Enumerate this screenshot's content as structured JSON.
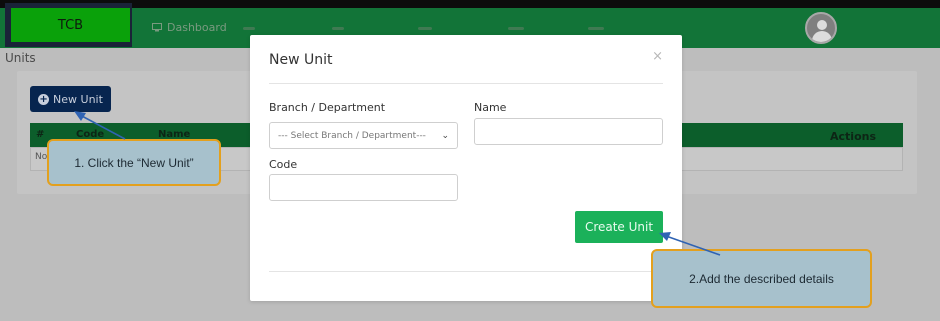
{
  "navbar": {
    "brand": "TCB",
    "dashboard_label": "Dashboard"
  },
  "page": {
    "title": "Units",
    "new_unit_button": "New Unit",
    "table": {
      "columns": [
        "#",
        "Code",
        "Name"
      ],
      "actions_header": "Actions",
      "empty_row_text": "No"
    }
  },
  "modal": {
    "title": "New Unit",
    "close": "×",
    "branch_label": "Branch / Department",
    "branch_placeholder": "--- Select Branch / Department---",
    "name_label": "Name",
    "name_value": "",
    "code_label": "Code",
    "code_value": "",
    "create_button": "Create Unit"
  },
  "callouts": {
    "step1": "1. Click the “New Unit”",
    "step2": "2.Add the described details"
  },
  "colors": {
    "navbar_green": "#127438",
    "brand_green": "#0aa10a",
    "button_navy": "#07254f",
    "create_green": "#1bb15a",
    "callout_fill": "#a7c1cc",
    "callout_border": "#e3a01e",
    "arrow_blue": "#2f63b3"
  }
}
